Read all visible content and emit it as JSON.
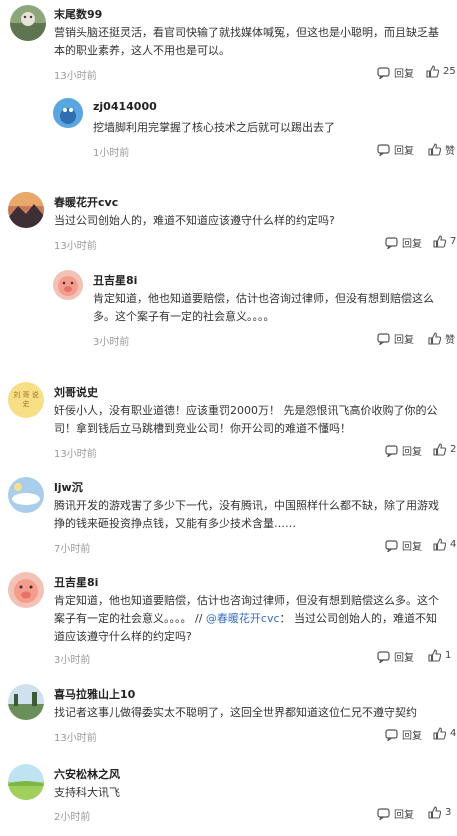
{
  "reply_label": "回复",
  "comments": [
    {
      "user": "末尾数99",
      "text": "营销头脑还挺灵活，看官司快输了就找媒体喊冤，但这也是小聪明，而且缺乏基本的职业素养，这人不用也是可以。",
      "time": "13小时前",
      "likes": "25",
      "avatar": "cat-landscape-avatar"
    },
    {
      "user": "zj0414000",
      "text": "挖墙脚利用完掌握了核心技术之后就可以踢出去了",
      "time": "1小时前",
      "likes": "赞",
      "avatar": "blue-bird-avatar"
    },
    {
      "user": "春暖花开cvc",
      "text": "当过公司创始人的，难道不知道应该遵守什么样的约定吗?",
      "time": "13小时前",
      "likes": "7",
      "avatar": "sunset-mountain-avatar"
    },
    {
      "user": "丑吉星8i",
      "text": "肯定知道，他也知道要赔偿，估计也咨询过律师，但没有想到赔偿这么多。这个案子有一定的社会意义。。。。",
      "time": "3小时前",
      "likes": "赞",
      "avatar": "pig-avatar"
    },
    {
      "user": "刘哥说史",
      "text": "奸佞小人，没有职业道德！应该重罚2000万！ 先是怨恨讯飞高价收购了你的公司！拿到钱后立马跳槽到竞业公司！你开公司的难道不懂吗！",
      "time": "13小时前",
      "likes": "2",
      "avatar": "yellow-text-avatar",
      "avatar_text": "刘 哥 说 史"
    },
    {
      "user": "ljw沉",
      "text": "腾讯开发的游戏害了多少下一代，没有腾讯，中国照样什么都不缺，除了用游戏挣的钱来砸投资挣点钱，又能有多少技术含量……",
      "time": "7小时前",
      "likes": "4",
      "avatar": "sky-avatar"
    },
    {
      "user": "丑吉星8i",
      "text_before": "肯定知道，他也知道要赔偿，估计也咨询过律师，但没有想到赔偿这么多。这个案子有一定的社会意义。。。。 // ",
      "mention": "@春暖花开cvc",
      "text_after": "： 当过公司创始人的，难道不知道应该遵守什么样的约定吗?",
      "time": "3小时前",
      "likes": "1",
      "avatar": "pig-avatar"
    },
    {
      "user": "喜马拉雅山上10",
      "text": "找记者这事儿做得委实太不聪明了，这回全世界都知道这位仁兄不遵守契约",
      "time": "13小时前",
      "likes": "4",
      "avatar": "lake-avatar"
    },
    {
      "user": "六安松林之风",
      "text": "支持科大讯飞",
      "time": "2小时前",
      "likes": "3",
      "avatar": "green-field-avatar"
    }
  ]
}
